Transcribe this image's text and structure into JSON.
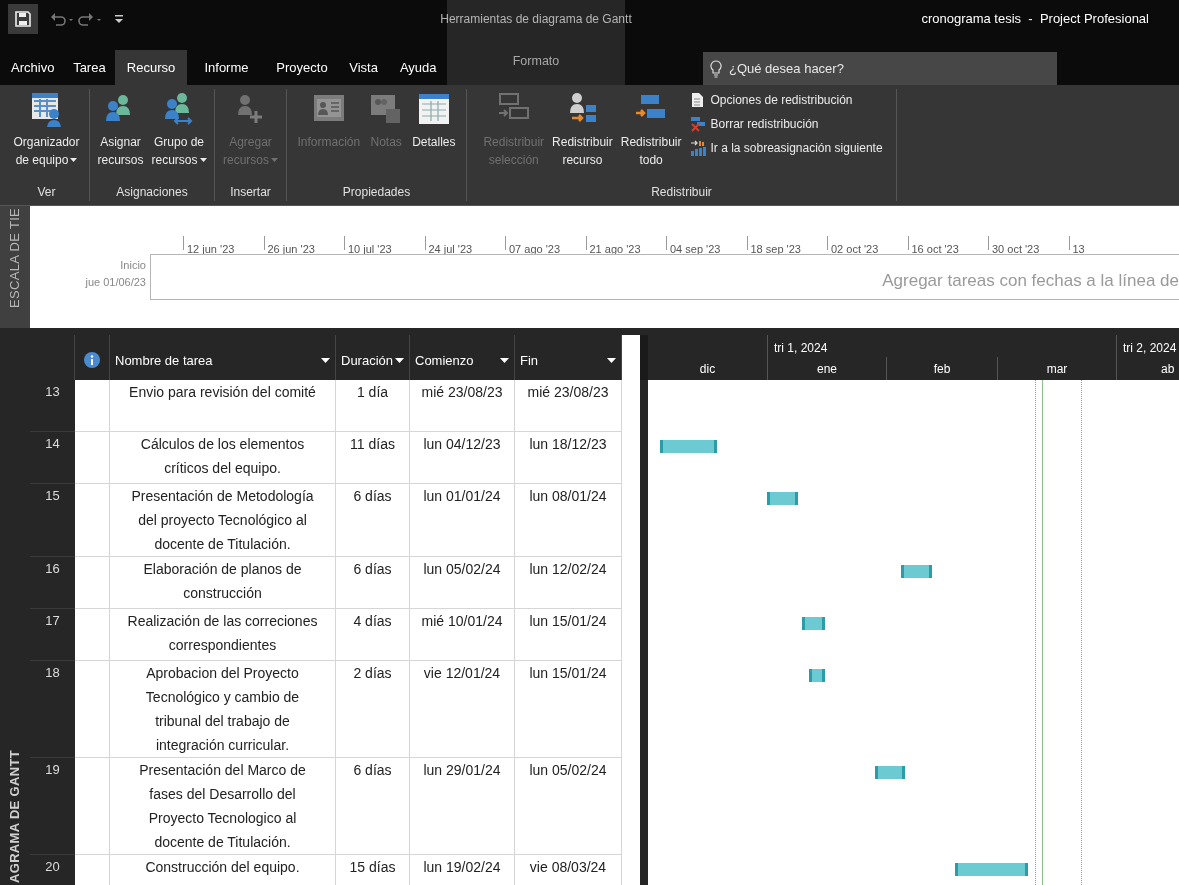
{
  "window": {
    "title": "cronograma tesis  -  Project Profesional"
  },
  "contextual_tab": {
    "group": "Herramientas de diagrama de Gantt",
    "tab": {
      "label": "Formato",
      "selected": false
    }
  },
  "tabs": [
    {
      "label": "Archivo",
      "selected": false
    },
    {
      "label": "Tarea",
      "selected": false
    },
    {
      "label": "Recurso",
      "selected": true
    },
    {
      "label": "Informe",
      "selected": false
    },
    {
      "label": "Proyecto",
      "selected": false
    },
    {
      "label": "Vista",
      "selected": false
    },
    {
      "label": "Ayuda",
      "selected": false
    }
  ],
  "search": {
    "placeholder": "¿Qué desea hacer?"
  },
  "ribbon": {
    "groups": [
      {
        "label": "Ver",
        "buttons": [
          {
            "kind": "large",
            "label": "Organizador\nde equipo",
            "menu": true,
            "disabled": false
          }
        ]
      },
      {
        "label": "Asignaciones",
        "buttons": [
          {
            "kind": "large",
            "label": "Asignar\nrecursos",
            "menu": false,
            "disabled": false
          },
          {
            "kind": "large",
            "label": "Grupo de\nrecursos",
            "menu": true,
            "disabled": false
          }
        ]
      },
      {
        "label": "Insertar",
        "buttons": [
          {
            "kind": "large",
            "label": "Agregar\nrecursos",
            "menu": true,
            "disabled": true
          }
        ]
      },
      {
        "label": "Propiedades",
        "buttons": [
          {
            "kind": "large",
            "label": "Información",
            "menu": false,
            "disabled": true
          },
          {
            "kind": "large",
            "label": "Notas",
            "menu": false,
            "disabled": true
          },
          {
            "kind": "large",
            "label": "Detalles",
            "menu": false,
            "disabled": false
          }
        ]
      },
      {
        "label": "Redistribuir",
        "buttons": [
          {
            "kind": "large",
            "label": "Redistribuir\nselección",
            "menu": false,
            "disabled": true
          },
          {
            "kind": "large",
            "label": "Redistribuir\nrecurso",
            "menu": false,
            "disabled": false
          },
          {
            "kind": "large",
            "label": "Redistribuir\ntodo",
            "menu": false,
            "disabled": false
          },
          {
            "kind": "small",
            "label": "Opciones de redistribución",
            "menu": false,
            "disabled": false
          },
          {
            "kind": "small",
            "label": "Borrar redistribución",
            "menu": false,
            "disabled": false
          },
          {
            "kind": "small",
            "label": "Ir a la sobreasignación siguiente",
            "menu": false,
            "disabled": false
          }
        ]
      }
    ]
  },
  "timeline": {
    "pane_label": "ESCALA DE TIE",
    "start_label": "Inicio",
    "start_date": "jue 01/06/23",
    "ticks": [
      "12 jun '23",
      "26 jun '23",
      "10 jul '23",
      "24 jul '23",
      "07 ago '23",
      "21 ago '23",
      "04 sep '23",
      "18 sep '23",
      "02 oct '23",
      "16 oct '23",
      "30 oct '23",
      "13"
    ],
    "placeholder": "Agregar tareas con fechas a la línea de"
  },
  "view_label": "AGRAMA DE GANTT",
  "table": {
    "columns": [
      {
        "label": "Nombre de tarea"
      },
      {
        "label": "Duración"
      },
      {
        "label": "Comienzo"
      },
      {
        "label": "Fin"
      }
    ],
    "rows": [
      {
        "id": "13",
        "name": "Envio para revisión del comité",
        "duration": "1 día",
        "start": "mié 23/08/23",
        "finish": "mié 23/08/23"
      },
      {
        "id": "14",
        "name": "Cálculos de los elementos críticos del equipo.",
        "duration": "11 días",
        "start": "lun 04/12/23",
        "finish": "lun 18/12/23"
      },
      {
        "id": "15",
        "name": "Presentación de Metodología del proyecto Tecnológico al docente de Titulación.",
        "duration": "6 días",
        "start": "lun 01/01/24",
        "finish": "lun 08/01/24"
      },
      {
        "id": "16",
        "name": "Elaboración de planos de construcción",
        "duration": "6 días",
        "start": "lun 05/02/24",
        "finish": "lun 12/02/24"
      },
      {
        "id": "17",
        "name": "Realización de las correciones correspondientes",
        "duration": "4 días",
        "start": "mié 10/01/24",
        "finish": "lun 15/01/24"
      },
      {
        "id": "18",
        "name": "Aprobacion del Proyecto Tecnológico y cambio de tribunal del trabajo de integración curricular.",
        "duration": "2 días",
        "start": "vie 12/01/24",
        "finish": "lun 15/01/24"
      },
      {
        "id": "19",
        "name": "Presentación del Marco de fases del Desarrollo del Proyecto Tecnologico al docente de Titulación.",
        "duration": "6 días",
        "start": "lun 29/01/24",
        "finish": "lun 05/02/24"
      },
      {
        "id": "20",
        "name": "Construcción del equipo.",
        "duration": "15 días",
        "start": "lun 19/02/24",
        "finish": "vie 08/03/24"
      }
    ]
  },
  "gantt": {
    "quarters": [
      "tri 1, 2024",
      "tri 2, 2024"
    ],
    "months": [
      "dic",
      "ene",
      "feb",
      "mar",
      "ab"
    ]
  }
}
